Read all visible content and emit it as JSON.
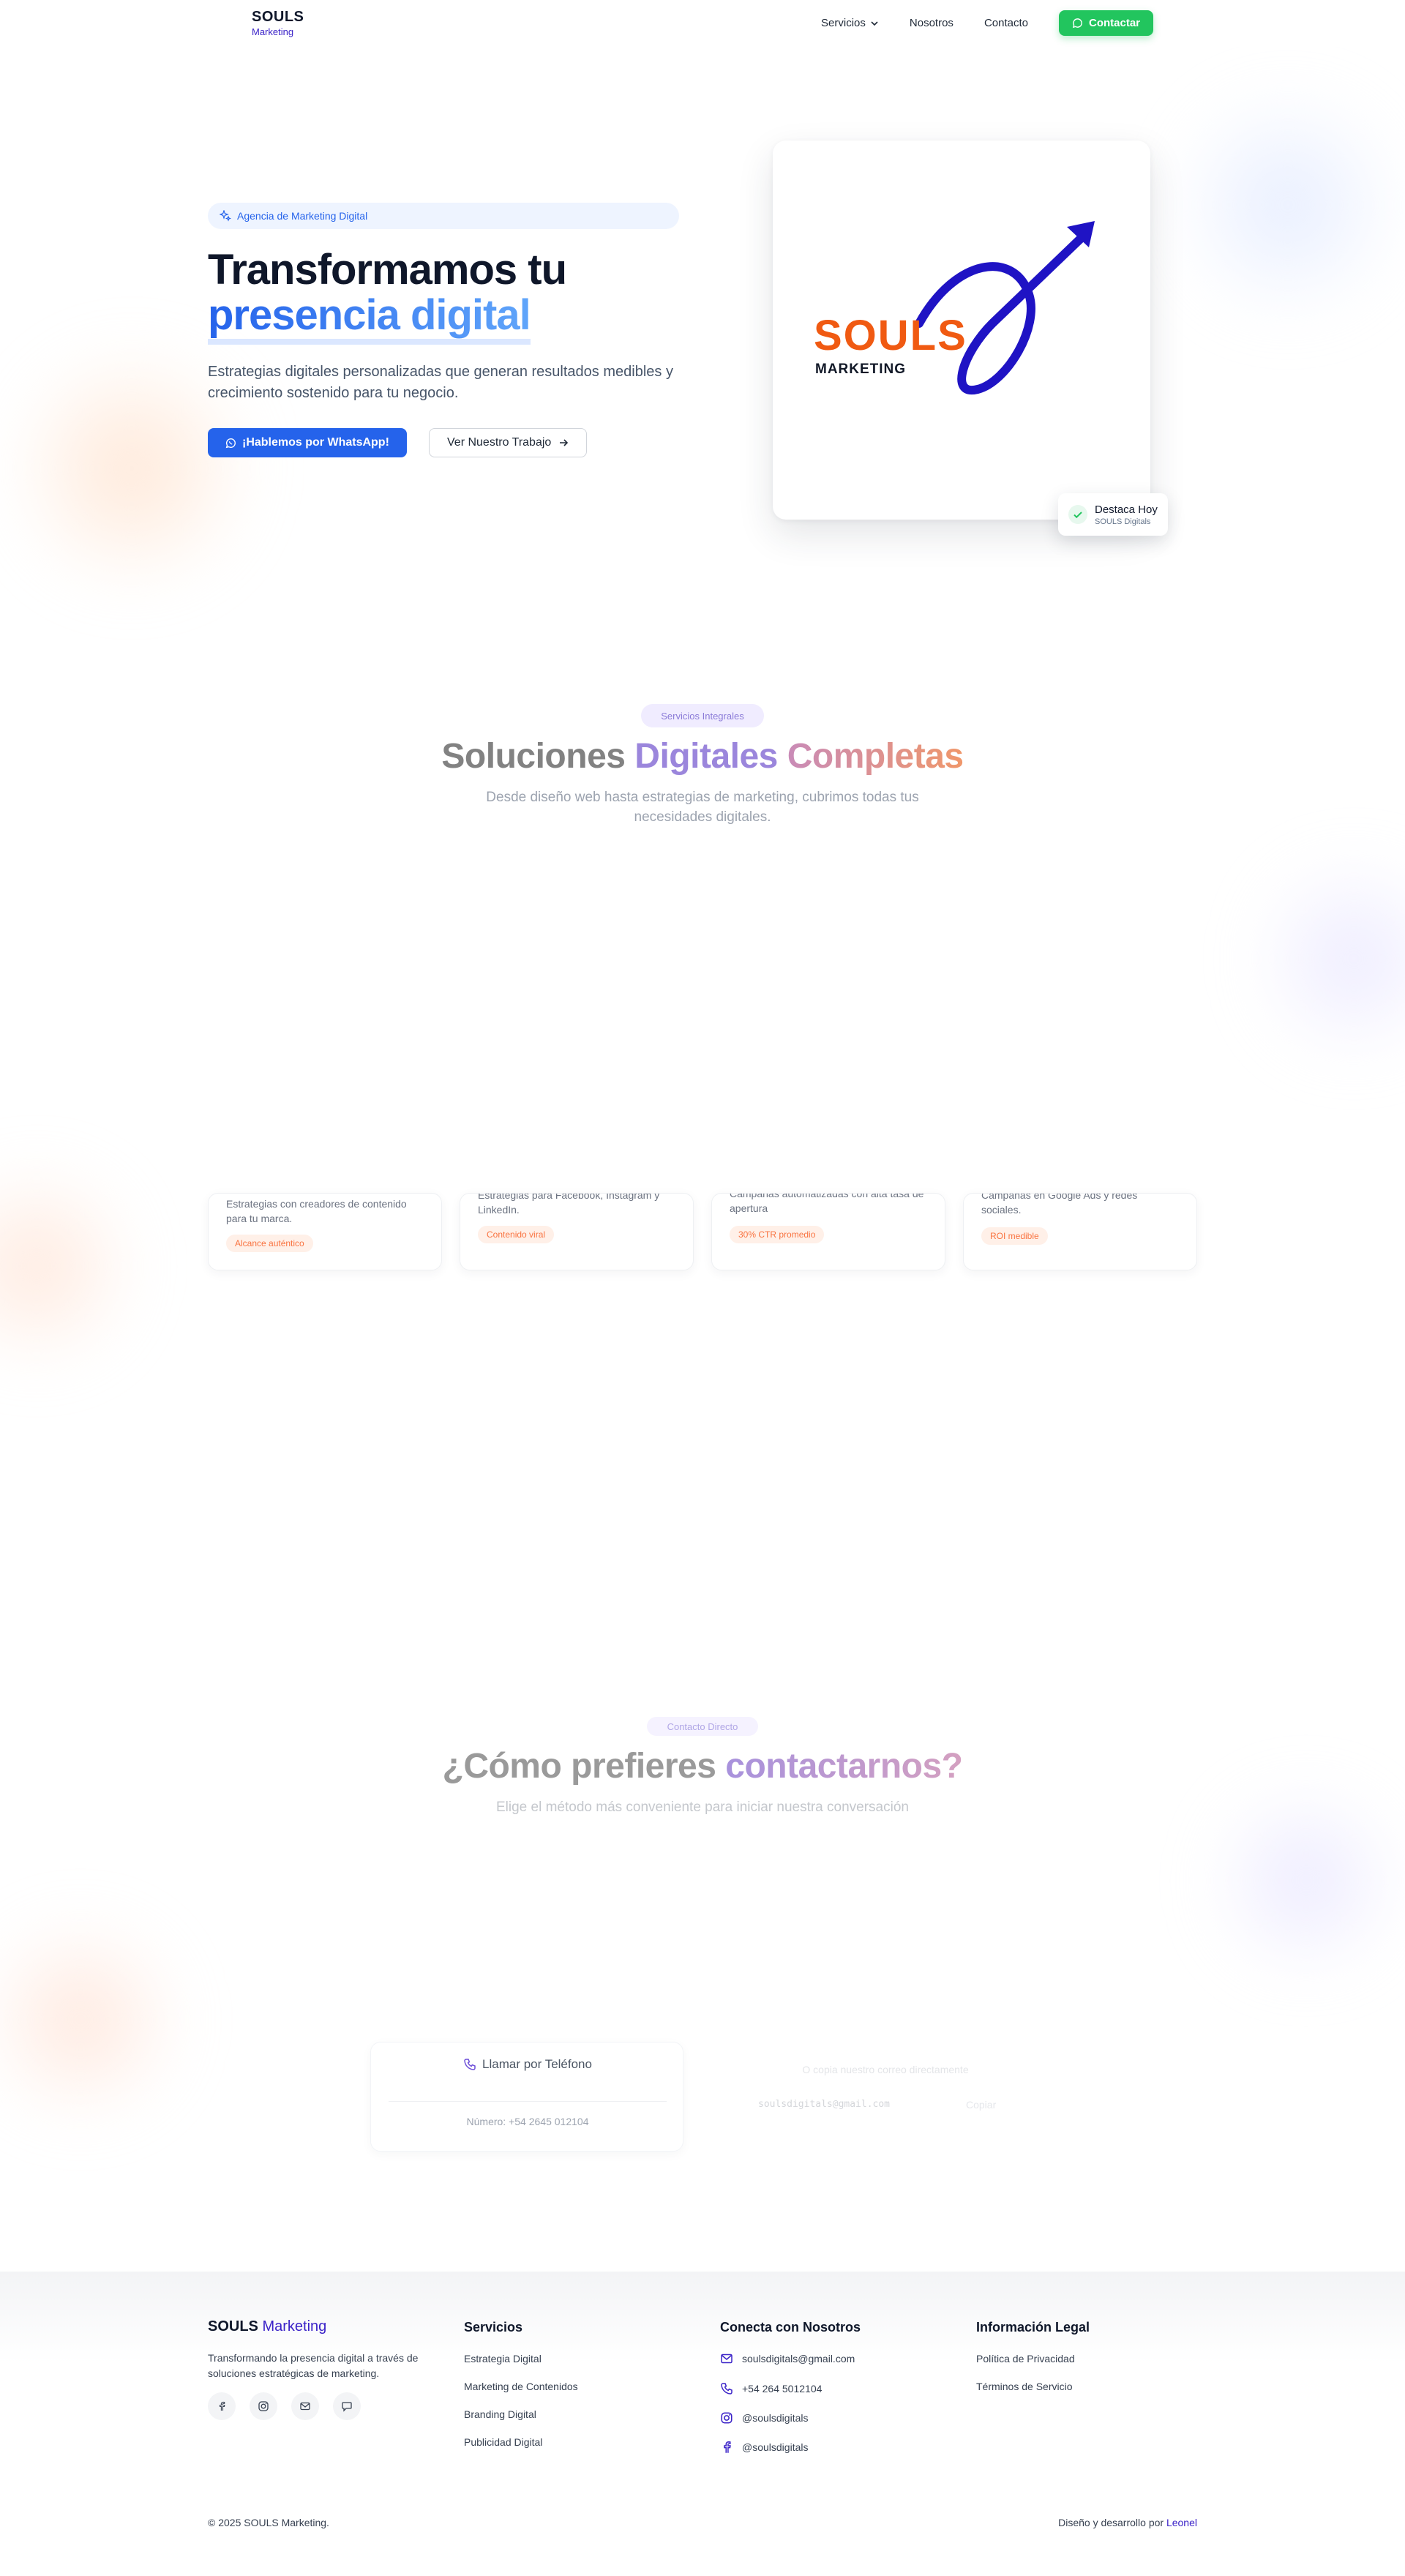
{
  "nav": {
    "logo_main": "SOULS",
    "logo_sub": "Marketing",
    "links": [
      "Servicios",
      "Nosotros",
      "Contacto"
    ],
    "cta": "Contactar"
  },
  "hero": {
    "badge": "Agencia de Marketing Digital",
    "title_line1": "Transformamos tu",
    "title_line2": "presencia digital",
    "subtitle": "Estrategias digitales personalizadas que generan resultados medibles y crecimiento sostenido para tu negocio.",
    "primary_cta": "¡Hablemos por WhatsApp!",
    "secondary_cta": "Ver Nuestro Trabajo",
    "card_logo_main": "SOULS",
    "card_logo_sub": "MARKETING",
    "toast_title": "Destaca Hoy",
    "toast_sub": "SOULS Digitals"
  },
  "services": {
    "pill": "Servicios Integrales",
    "title_a": "Soluciones ",
    "title_b": "Digitales ",
    "title_c": "Completas",
    "subtitle": "Desde diseño web hasta estrategias de marketing, cubrimos todas tus necesidades digitales.",
    "cards": [
      {
        "text": "Estrategias con creadores de contenido para tu marca.",
        "tag": "Alcance auténtico"
      },
      {
        "text": "Estrategias para Facebook, Instagram y LinkedIn.",
        "tag": "Contenido viral"
      },
      {
        "text": "Campañas automatizadas con alta tasa de apertura",
        "tag": "30% CTR promedio"
      },
      {
        "text": "Campañas en Google Ads y redes sociales.",
        "tag": "ROI medible"
      }
    ]
  },
  "contact": {
    "pill": "Contacto Directo",
    "title_a": "¿Cómo prefieres ",
    "title_b": "contactarnos?",
    "subtitle": "Elige el método más conveniente para iniciar nuestra conversación",
    "phone_title": "Llamar por Teléfono",
    "phone_number": "Número: +54 2645 012104",
    "email_hint": "O copia nuestro correo directamente",
    "email_value": "soulsdigitals@gmail.com",
    "copy_label": "Copiar"
  },
  "footer": {
    "brand_main": "SOULS",
    "brand_sub": "Marketing",
    "brand_desc": "Transformando la presencia digital a través de soluciones estratégicas de marketing.",
    "services_title": "Servicios",
    "services": [
      "Estrategia Digital",
      "Marketing de Contenidos",
      "Branding Digital",
      "Publicidad Digital"
    ],
    "connect_title": "Conecta con Nosotros",
    "connect": [
      "soulsdigitals@gmail.com",
      "+54 264 5012104",
      "@soulsdigitals",
      "@soulsdigitals"
    ],
    "legal_title": "Información Legal",
    "legal": [
      "Política de Privacidad",
      "Términos de Servicio"
    ],
    "copyright": "© 2025 SOULS Marketing.",
    "credit_prefix": "Diseño y desarrollo por ",
    "credit_name": "Leonel"
  },
  "colors": {
    "brand_blue": "#2563eb",
    "brand_purple": "#3b23c8",
    "whatsapp_green": "#22c55e",
    "accent_orange": "#f97340",
    "logo_orange": "#f05a12"
  },
  "icons": [
    "sparkles-icon",
    "chevron-down-icon",
    "chat-icon",
    "whatsapp-icon",
    "arrow-right-icon",
    "check-icon",
    "phone-icon",
    "facebook-icon",
    "instagram-icon",
    "mail-icon",
    "message-icon"
  ]
}
